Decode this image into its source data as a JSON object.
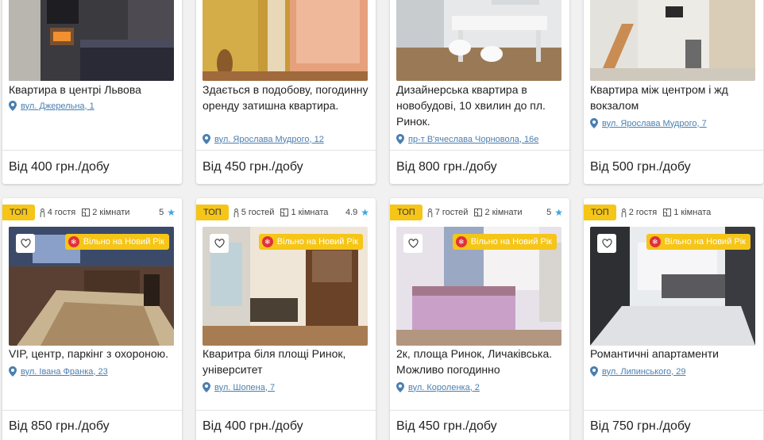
{
  "listings_top": [
    {
      "title": "Квартира в центрі Львова",
      "address": "вул. Джерельна, 1",
      "price": "Від 400 грн./добу"
    },
    {
      "title": "Здається в подобову, погодинну оренду затишна квартира.",
      "address": "вул. Ярослава Мудрого, 12",
      "price": "Від 450 грн./добу"
    },
    {
      "title": "Дизайнерська квартира в новобудові, 10 хвилин до пл. Ринок.",
      "address": "пр-т В'ячеслава Чорновола, 16е",
      "price": "Від 800 грн./добу"
    },
    {
      "title": "Квартира між центром і жд вокзалом",
      "address": "вул. Ярослава Мудрого, 7",
      "price": "Від 500 грн./добу"
    }
  ],
  "listings_bottom": [
    {
      "badge": "ТОП",
      "guests": "4 гостя",
      "rooms": "2 кімнати",
      "rating": "5",
      "ny_badge": "Вільно на Новий Рік",
      "title": "VIP, центр, паркінг з охороною.",
      "address": "вул. Івана Франка, 23",
      "price": "Від 850 грн./добу"
    },
    {
      "badge": "ТОП",
      "guests": "5 гостей",
      "rooms": "1 кімната",
      "rating": "4.9",
      "ny_badge": "Вільно на Новий Рік",
      "title": "Кваритра біля площі Ринок, університет",
      "address": "вул. Шопена, 7",
      "price": "Від 400 грн./добу"
    },
    {
      "badge": "ТОП",
      "guests": "7 гостей",
      "rooms": "2 кімнати",
      "rating": "5",
      "ny_badge": "Вільно на Новий Рік",
      "title": "2к, площа Ринок, Личаківська. Можливо погодинно",
      "address": "вул. Короленка, 2",
      "price": "Від 450 грн./добу"
    },
    {
      "badge": "ТОП",
      "guests": "2 гостя",
      "rooms": "1 кімната",
      "rating": "",
      "ny_badge": "Вільно на Новий Рік",
      "title": "Романтичні апартаменти",
      "address": "вул. Липинського, 29",
      "price": "Від 750 грн./добу"
    }
  ],
  "colors": {
    "accent": "#f5c518",
    "link": "#4a7fb0",
    "star": "#3aa8dc",
    "ny_dot": "#e0313a"
  },
  "icons": {
    "address": "map-pin-icon",
    "guests": "person-icon",
    "rooms": "floorplan-icon",
    "rating": "star-icon",
    "favorite": "heart-icon",
    "ny": "snowflake-icon"
  }
}
